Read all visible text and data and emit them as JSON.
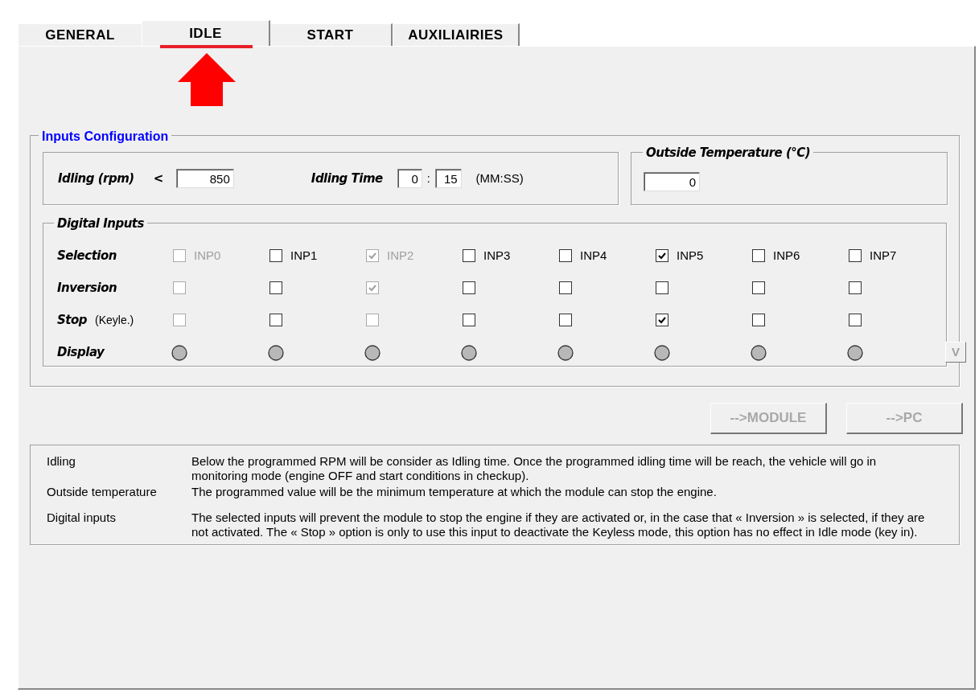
{
  "tabs": [
    {
      "label": "GENERAL",
      "selected": false
    },
    {
      "label": "IDLE",
      "selected": true,
      "highlighted": true
    },
    {
      "label": "START",
      "selected": false
    },
    {
      "label": "AUXILIAIRIES",
      "selected": false
    }
  ],
  "inputs_configuration": {
    "title": "Inputs Configuration",
    "idling": {
      "label": "Idling (rpm)",
      "operator": "<",
      "value": "850"
    },
    "idling_time": {
      "label": "Idling Time",
      "minutes": "0",
      "separator": ":",
      "seconds": "15",
      "unit": "(MM:SS)"
    },
    "outside_temperature": {
      "title": "Outside Temperature (°C)",
      "value": "0"
    },
    "digital_inputs": {
      "title": "Digital Inputs",
      "row_labels": {
        "selection": "Selection",
        "inversion": "Inversion",
        "stop": "Stop",
        "stop_note": "(Keyle.)",
        "display": "Display"
      },
      "inputs": [
        {
          "label": "INP0",
          "selection": {
            "checked": false,
            "disabled": true
          },
          "inversion": {
            "checked": false,
            "disabled": true
          },
          "stop": {
            "checked": false,
            "disabled": true
          }
        },
        {
          "label": "INP1",
          "selection": {
            "checked": false,
            "disabled": false
          },
          "inversion": {
            "checked": false,
            "disabled": false
          },
          "stop": {
            "checked": false,
            "disabled": false
          }
        },
        {
          "label": "INP2",
          "selection": {
            "checked": true,
            "disabled": true
          },
          "inversion": {
            "checked": true,
            "disabled": true
          },
          "stop": {
            "checked": false,
            "disabled": true
          }
        },
        {
          "label": "INP3",
          "selection": {
            "checked": false,
            "disabled": false
          },
          "inversion": {
            "checked": false,
            "disabled": false
          },
          "stop": {
            "checked": false,
            "disabled": false
          }
        },
        {
          "label": "INP4",
          "selection": {
            "checked": false,
            "disabled": false
          },
          "inversion": {
            "checked": false,
            "disabled": false
          },
          "stop": {
            "checked": false,
            "disabled": false
          }
        },
        {
          "label": "INP5",
          "selection": {
            "checked": true,
            "disabled": false
          },
          "inversion": {
            "checked": false,
            "disabled": false
          },
          "stop": {
            "checked": true,
            "disabled": false
          }
        },
        {
          "label": "INP6",
          "selection": {
            "checked": false,
            "disabled": false
          },
          "inversion": {
            "checked": false,
            "disabled": false
          },
          "stop": {
            "checked": false,
            "disabled": false
          }
        },
        {
          "label": "INP7",
          "selection": {
            "checked": false,
            "disabled": false
          },
          "inversion": {
            "checked": false,
            "disabled": false
          },
          "stop": {
            "checked": false,
            "disabled": false
          }
        }
      ],
      "v_button": {
        "label": "V",
        "disabled": true
      }
    }
  },
  "buttons": [
    {
      "label": "-->MODULE",
      "disabled": true
    },
    {
      "label": "-->PC",
      "disabled": true
    }
  ],
  "help": [
    {
      "term": "Idling",
      "text": "Below the programmed RPM will be consider as Idling time. Once the programmed idling time will be reach, the vehicle will go in monitoring mode (engine OFF and start conditions in checkup)."
    },
    {
      "term": "Outside temperature",
      "text": "The programmed value will be the minimum temperature at which the module can stop the engine."
    },
    {
      "term": "Digital inputs",
      "text": "The selected inputs will prevent the module to stop the engine if they are activated or, in the case that « Inversion » is selected, if they are not activated. The « Stop » option is only to use this input to deactivate the Keyless mode, this option has no effect in Idle mode (key in)."
    }
  ]
}
